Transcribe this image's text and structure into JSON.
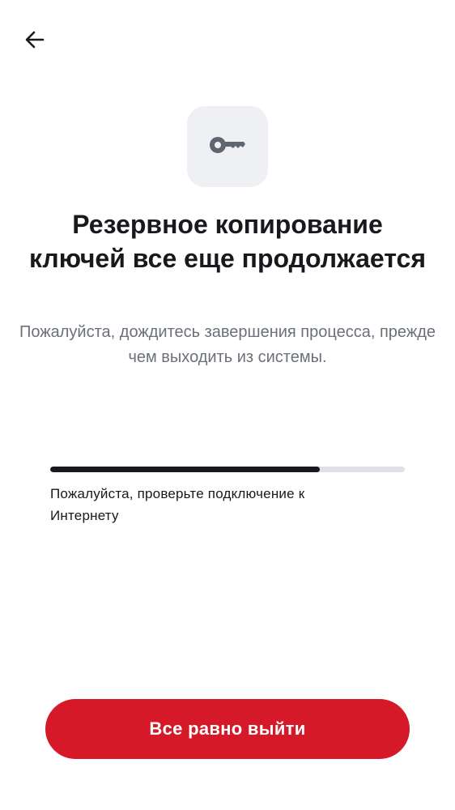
{
  "header": {
    "back_icon": "arrow-left-icon"
  },
  "hero": {
    "icon": "key-icon",
    "title": "Резервное копирование ключей все еще продолжается",
    "subtitle": "Пожалуйста, дождитесь завершения процесса, прежде чем выходить из системы."
  },
  "progress": {
    "fraction": 0.76,
    "status": "Пожалуйста, проверьте подключение к Интернету"
  },
  "actions": {
    "exit_label": "Все равно выйти"
  },
  "colors": {
    "accent": "#d61928",
    "progress_fill": "#17191c",
    "progress_track": "#dfe1e6",
    "icon_tile": "#eef0f4"
  }
}
